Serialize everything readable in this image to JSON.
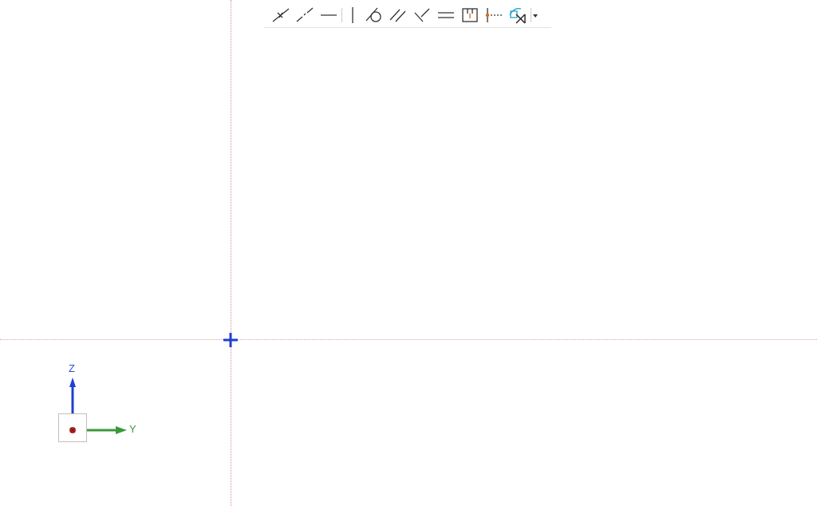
{
  "viewport": {
    "background_color": "#ffffff",
    "axis_line_color": "#d98a9a",
    "origin_marker_color": "#1f3fd1"
  },
  "toolbar": {
    "tools": [
      {
        "name": "coincident-constraint",
        "icon": "coincident-icon"
      },
      {
        "name": "collinear-constraint",
        "icon": "collinear-icon"
      },
      {
        "name": "horizontal-constraint",
        "icon": "horizontal-icon"
      },
      {
        "name": "vertical-constraint",
        "icon": "vertical-icon"
      },
      {
        "name": "tangent-constraint",
        "icon": "tangent-icon"
      },
      {
        "name": "parallel-constraint",
        "icon": "parallel-icon"
      },
      {
        "name": "perpendicular-constraint",
        "icon": "perpendicular-icon"
      },
      {
        "name": "equal-constraint",
        "icon": "equal-icon"
      },
      {
        "name": "fix-constraint",
        "icon": "fix-icon"
      },
      {
        "name": "midpoint-constraint",
        "icon": "midpoint-icon"
      },
      {
        "name": "show-constraints",
        "icon": "show-constraints-icon"
      }
    ],
    "icon_color": "#333333",
    "accent_color": "#d56a1a",
    "highlight_color": "#27a6c8"
  },
  "triad": {
    "z_label": "Z",
    "y_label": "Y",
    "z_color": "#1f3fd1",
    "y_color": "#3a9a3a",
    "point_color": "#b02525"
  }
}
